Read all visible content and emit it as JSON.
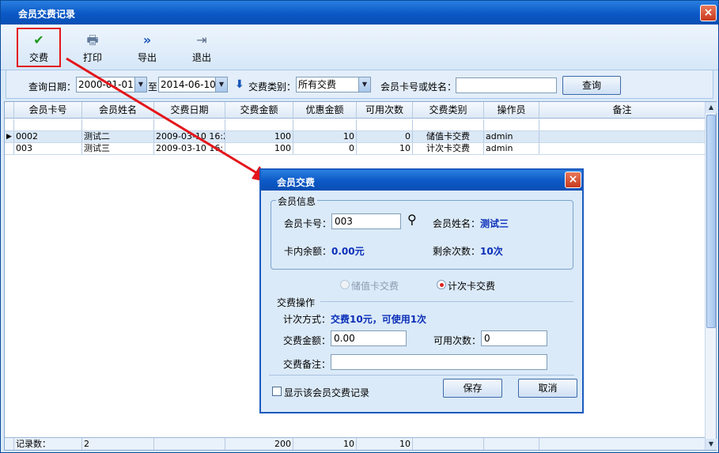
{
  "window": {
    "title": "会员交费记录",
    "close": "×"
  },
  "toolbar": {
    "pay": {
      "label": "交费",
      "icon": "check-icon",
      "glyph": "✔"
    },
    "print": {
      "label": "打印",
      "icon": "printer-icon",
      "glyph": "🖶"
    },
    "export": {
      "label": "导出",
      "icon": "export-icon",
      "glyph": "»"
    },
    "exit": {
      "label": "退出",
      "icon": "exit-icon",
      "glyph": "⇥"
    }
  },
  "filter": {
    "date_label": "查询日期：",
    "date_from": "2000-01-01",
    "to_label": "至",
    "date_to": "2014-06-10",
    "type_label": "交费类别：",
    "type_value": "所有交费",
    "card_label": "会员卡号或姓名：",
    "card_value": "",
    "query_button": "查询"
  },
  "grid": {
    "columns": [
      "会员卡号",
      "会员姓名",
      "交费日期",
      "交费金额",
      "优惠金额",
      "可用次数",
      "交费类别",
      "操作员",
      "备注"
    ],
    "rows": [
      {
        "card": "0002",
        "name": "测试二",
        "date": "2009-03-10 16:2",
        "amount": "100",
        "discount": "10",
        "count": "0",
        "type": "储值卡交费",
        "operator": "admin",
        "note": ""
      },
      {
        "card": "003",
        "name": "测试三",
        "date": "2009-03-10 16:",
        "amount": "100",
        "discount": "0",
        "count": "10",
        "type": "计次卡交费",
        "operator": "admin",
        "note": ""
      }
    ],
    "footer": {
      "label": "记录数：",
      "count": "2",
      "amount": "200",
      "discount": "10",
      "times": "10"
    }
  },
  "dialog": {
    "title": "会员交费",
    "close": "×",
    "member_group": "会员信息",
    "card_label": "会员卡号：",
    "card_value": "003",
    "name_label": "会员姓名：",
    "name_value": "测试三",
    "balance_label": "卡内余额：",
    "balance_value": "0.00元",
    "remaining_label": "剩余次数：",
    "remaining_value": "10次",
    "radio_stored": "储值卡交费",
    "radio_count": "计次卡交费",
    "op_group": "交费操作",
    "method_label": "计次方式：",
    "method_value": "交费10元，可使用1次",
    "amount_label": "交费金额：",
    "amount_value": "0.00",
    "times_label": "可用次数：",
    "times_value": "0",
    "note_label": "交费备注：",
    "note_value": "",
    "show_records": "显示该会员交费记录",
    "save": "保存",
    "cancel": "取消"
  },
  "colors": {
    "accent": "#0b58c6",
    "highlight": "#e4161b",
    "value_text": "#0b2fb8"
  }
}
